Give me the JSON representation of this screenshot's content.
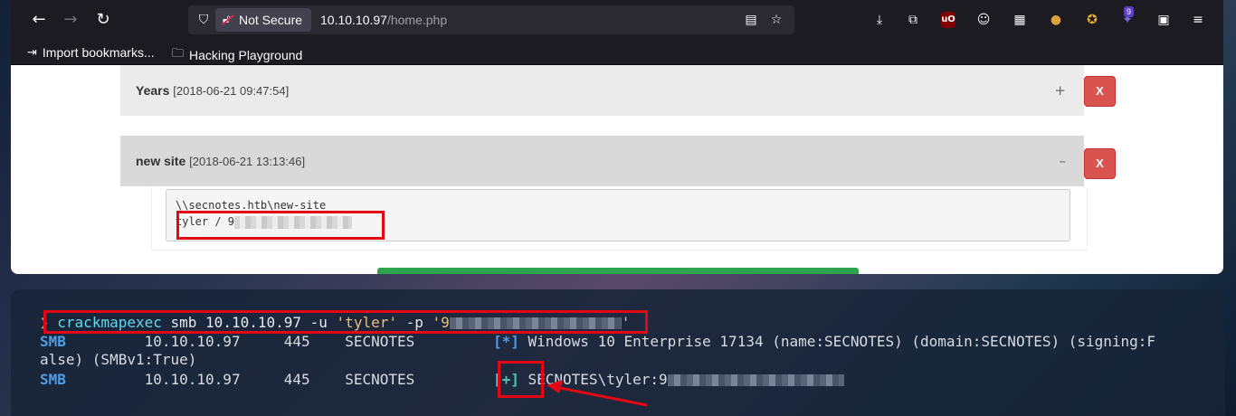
{
  "browser": {
    "nav": {
      "back_icon": "arrow-left-icon",
      "forward_icon": "arrow-right-icon",
      "reload_icon": "reload-icon"
    },
    "urlbar": {
      "security_label": "Not Secure",
      "host": "10.10.10.97",
      "path": "/home.php"
    },
    "toolbar_badge": "9",
    "bookmarks": [
      {
        "label": "Import bookmarks..."
      },
      {
        "label": "Hacking Playground"
      }
    ]
  },
  "notes": [
    {
      "title": "Years",
      "timestamp": "[2018-06-21 09:47:54]",
      "toggle": "+",
      "delete_label": "X"
    },
    {
      "title": "new site",
      "timestamp": "[2018-06-21 13:13:46]",
      "toggle": "–",
      "delete_label": "X",
      "body_line1": "\\\\secnotes.htb\\new-site",
      "body_line2_prefix": "tyler / 9"
    }
  ],
  "terminal": {
    "prompt": "❯",
    "command": "crackmapexec",
    "args": "smb 10.10.10.97 -u",
    "user_arg": "'tyler'",
    "pass_flag": "-p",
    "pass_prefix": "'9",
    "pass_suffix": "'",
    "rows": [
      {
        "proto": "SMB",
        "host": "10.10.10.97",
        "port": "445",
        "name": "SECNOTES",
        "status": "[*]",
        "message": "Windows 10 Enterprise 17134 (name:SECNOTES) (domain:SECNOTES) (signing:F",
        "message_cont": "alse) (SMBv1:True)"
      },
      {
        "proto": "SMB",
        "host": "10.10.10.97",
        "port": "445",
        "name": "SECNOTES",
        "status": "[+]",
        "message": "SECNOTES\\tyler:9"
      }
    ]
  },
  "colors": {
    "highlight": "#e30613",
    "delete_button": "#d9534f",
    "smb_blue": "#4d9ee8",
    "success_teal": "#4ec9b0"
  }
}
